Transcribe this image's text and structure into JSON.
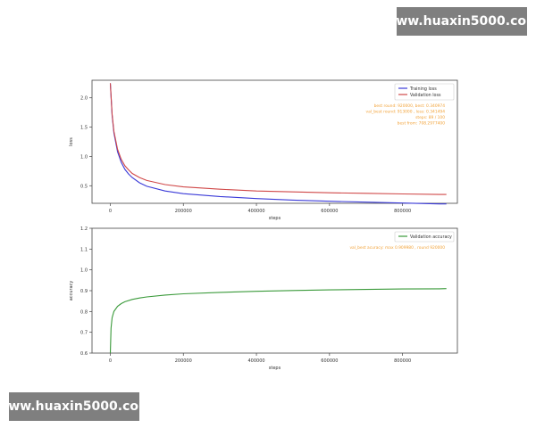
{
  "watermark": {
    "top_text": "www.huaxin5000.com",
    "bottom_text": "www.huaxin5000.com"
  },
  "chart_data": [
    {
      "type": "line",
      "xlabel": "steps",
      "ylabel": "loss",
      "xlim": [
        -50000,
        950000
      ],
      "ylim": [
        0.2,
        2.3
      ],
      "xticks": [
        0,
        200000,
        400000,
        600000,
        800000
      ],
      "yticks": [
        0.5,
        1.0,
        1.5,
        2.0
      ],
      "grid": false,
      "legend_position": "top-right",
      "series": [
        {
          "name": "Training loss",
          "color": "#3a3ad8",
          "x": [
            0,
            5000,
            10000,
            20000,
            30000,
            40000,
            50000,
            60000,
            80000,
            100000,
            150000,
            200000,
            300000,
            400000,
            500000,
            600000,
            700000,
            800000,
            900000,
            920000
          ],
          "y": [
            2.25,
            1.7,
            1.4,
            1.08,
            0.9,
            0.78,
            0.7,
            0.64,
            0.55,
            0.49,
            0.41,
            0.365,
            0.315,
            0.28,
            0.255,
            0.235,
            0.22,
            0.205,
            0.19,
            0.19
          ]
        },
        {
          "name": "Validation loss",
          "color": "#d04848",
          "x": [
            0,
            5000,
            10000,
            20000,
            30000,
            40000,
            50000,
            60000,
            80000,
            100000,
            150000,
            200000,
            300000,
            400000,
            500000,
            600000,
            700000,
            800000,
            900000,
            920000
          ],
          "y": [
            2.25,
            1.72,
            1.43,
            1.12,
            0.95,
            0.84,
            0.77,
            0.71,
            0.64,
            0.59,
            0.52,
            0.48,
            0.44,
            0.41,
            0.395,
            0.38,
            0.37,
            0.36,
            0.35,
            0.35
          ]
        }
      ],
      "annotations": [
        "best round: 920000, best: 0.340974",
        "val_best round: 913000 , loss: 0.341494",
        "steps: 89 / 100",
        "best from: 708.2977400"
      ],
      "annotation_color": "#f2a33a"
    },
    {
      "type": "line",
      "xlabel": "steps",
      "ylabel": "accuracy",
      "xlim": [
        -50000,
        950000
      ],
      "ylim": [
        0.6,
        1.2
      ],
      "xticks": [
        0,
        200000,
        400000,
        600000,
        800000
      ],
      "yticks": [
        0.6,
        0.7,
        0.8,
        0.9,
        1.0,
        1.1,
        1.2
      ],
      "grid": false,
      "legend_position": "top-right",
      "series": [
        {
          "name": "Validation accuracy",
          "color": "#3a9a3a",
          "x": [
            0,
            2000,
            5000,
            10000,
            20000,
            30000,
            40000,
            60000,
            80000,
            100000,
            150000,
            200000,
            300000,
            400000,
            500000,
            600000,
            700000,
            800000,
            900000,
            920000
          ],
          "y": [
            0.6,
            0.72,
            0.77,
            0.8,
            0.825,
            0.838,
            0.847,
            0.858,
            0.865,
            0.87,
            0.879,
            0.885,
            0.892,
            0.897,
            0.901,
            0.904,
            0.906,
            0.908,
            0.909,
            0.91
          ]
        }
      ],
      "annotations": [
        "val_best acuracy: max 0.909980 , round 920000"
      ],
      "annotation_color": "#f2a33a"
    }
  ]
}
